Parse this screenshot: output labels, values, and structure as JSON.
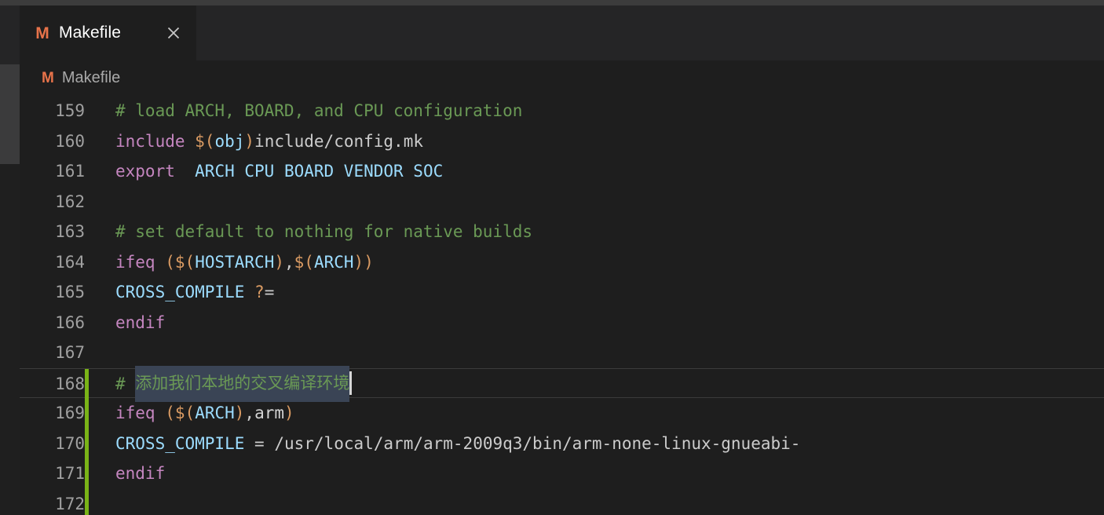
{
  "window": {
    "titlebar_color": "#3c3c3c",
    "editor_background": "#1e1e1e",
    "tabbar_background": "#252526"
  },
  "tab": {
    "icon": "makefile-icon",
    "icon_glyph": "M",
    "icon_color": "#e8734a",
    "label": "Makefile",
    "close_glyph": "×"
  },
  "breadcrumb": {
    "icon_glyph": "M",
    "icon_color": "#e8734a",
    "label": "Makefile"
  },
  "editor": {
    "language": "makefile",
    "first_line": 159,
    "cursor_line": 168,
    "selection_text": "添加我们本地的交叉编译环境",
    "modified_gutter_color": "#7ab317",
    "lines": [
      {
        "number": "159",
        "modified": false,
        "current": false,
        "tokens": [
          {
            "t": "# load ARCH, BOARD, and CPU configuration",
            "c": "c-comment"
          }
        ]
      },
      {
        "number": "160",
        "modified": false,
        "current": false,
        "tokens": [
          {
            "t": "include ",
            "c": "c-keyword"
          },
          {
            "t": "$(",
            "c": "c-bracket"
          },
          {
            "t": "obj",
            "c": "c-var"
          },
          {
            "t": ")",
            "c": "c-bracket"
          },
          {
            "t": "include/config.mk",
            "c": "c-path"
          }
        ]
      },
      {
        "number": "161",
        "modified": false,
        "current": false,
        "tokens": [
          {
            "t": "export",
            "c": "c-keyword"
          },
          {
            "t": "  ",
            "c": "c-plain"
          },
          {
            "t": "ARCH CPU BOARD VENDOR SOC",
            "c": "c-var"
          }
        ]
      },
      {
        "number": "162",
        "modified": false,
        "current": false,
        "tokens": []
      },
      {
        "number": "163",
        "modified": false,
        "current": false,
        "tokens": [
          {
            "t": "# set default to nothing for native builds",
            "c": "c-comment"
          }
        ]
      },
      {
        "number": "164",
        "modified": false,
        "current": false,
        "tokens": [
          {
            "t": "ifeq",
            "c": "c-keyword"
          },
          {
            "t": " ",
            "c": "c-plain"
          },
          {
            "t": "(",
            "c": "c-bracket"
          },
          {
            "t": "$(",
            "c": "c-bracket"
          },
          {
            "t": "HOSTARCH",
            "c": "c-var"
          },
          {
            "t": ")",
            "c": "c-bracket"
          },
          {
            "t": ",",
            "c": "c-punct"
          },
          {
            "t": "$(",
            "c": "c-bracket"
          },
          {
            "t": "ARCH",
            "c": "c-var"
          },
          {
            "t": ")",
            "c": "c-bracket"
          },
          {
            "t": ")",
            "c": "c-bracket"
          }
        ]
      },
      {
        "number": "165",
        "modified": false,
        "current": false,
        "tokens": [
          {
            "t": "CROSS_COMPILE",
            "c": "c-var"
          },
          {
            "t": " ",
            "c": "c-plain"
          },
          {
            "t": "?",
            "c": "c-bracket"
          },
          {
            "t": "=",
            "c": "c-punct"
          }
        ]
      },
      {
        "number": "166",
        "modified": false,
        "current": false,
        "tokens": [
          {
            "t": "endif",
            "c": "c-keyword"
          }
        ]
      },
      {
        "number": "167",
        "modified": false,
        "current": false,
        "tokens": []
      },
      {
        "number": "168",
        "modified": true,
        "current": true,
        "selected": true,
        "tokens": [
          {
            "t": "# ",
            "c": "c-comment"
          },
          {
            "t": "添加我们本地的交叉编译环境",
            "c": "c-comment",
            "sel": true
          }
        ]
      },
      {
        "number": "169",
        "modified": true,
        "current": false,
        "tokens": [
          {
            "t": "ifeq",
            "c": "c-keyword"
          },
          {
            "t": " ",
            "c": "c-plain"
          },
          {
            "t": "(",
            "c": "c-bracket"
          },
          {
            "t": "$(",
            "c": "c-bracket"
          },
          {
            "t": "ARCH",
            "c": "c-var"
          },
          {
            "t": ")",
            "c": "c-bracket"
          },
          {
            "t": ",",
            "c": "c-punct"
          },
          {
            "t": "arm",
            "c": "c-plain"
          },
          {
            "t": ")",
            "c": "c-bracket"
          }
        ]
      },
      {
        "number": "170",
        "modified": true,
        "current": false,
        "tokens": [
          {
            "t": "CROSS_COMPILE",
            "c": "c-var"
          },
          {
            "t": " ",
            "c": "c-plain"
          },
          {
            "t": "=",
            "c": "c-punct"
          },
          {
            "t": " /usr/local/arm/arm-2009q3/bin/arm-none-linux-gnueabi-",
            "c": "c-path"
          }
        ]
      },
      {
        "number": "171",
        "modified": true,
        "current": false,
        "tokens": [
          {
            "t": "endif",
            "c": "c-keyword"
          }
        ]
      },
      {
        "number": "172",
        "modified": true,
        "current": false,
        "tokens": []
      }
    ]
  }
}
